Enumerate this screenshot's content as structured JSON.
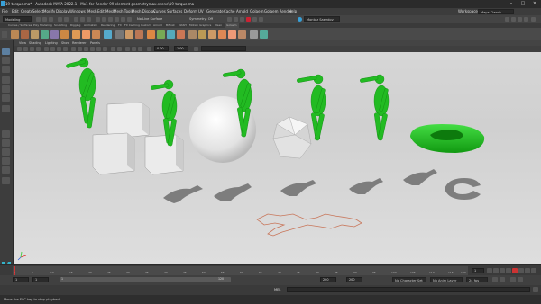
{
  "window": {
    "title": "19-torque.ma* - Autodesk MAYA 2022.1 - Mo1 for Render 99 element geometrymax.scene\\19-torque.ma"
  },
  "menubar": {
    "items": [
      "File",
      "Edit",
      "Create",
      "Select",
      "Modify",
      "Display",
      "Windows",
      "Mesh",
      "Edit Mesh",
      "Mesh Tools",
      "Mesh Display",
      "Curves",
      "Surfaces",
      "Deform",
      "UV",
      "Generate",
      "Cache",
      "Arnold",
      "Golaem",
      "Golaem Render",
      "Help"
    ],
    "workspace_label": "Workspace:",
    "workspace_value": "Maya Classic"
  },
  "statusline": {
    "mode": "Modeling",
    "no_live_surface": "No Live Surface",
    "symmetry": "Symmetry: Off",
    "sign_in": "Montaz Saeedov"
  },
  "shelf": {
    "tabs": [
      "Curves / Surfaces",
      "Poly Modeling",
      "Sculpting",
      "Rigging",
      "Animation",
      "Rendering",
      "FX",
      "FX Caching",
      "Custom",
      "Arnold",
      "Bifrost",
      "MASH",
      "Motion Graphics",
      "XGen",
      "Golaem"
    ]
  },
  "panel": {
    "menus": [
      "View",
      "Shading",
      "Lighting",
      "Show",
      "Renderer",
      "Panels"
    ],
    "near": "0.00",
    "far": "1.00"
  },
  "timeslider": {
    "ticks": [
      "1",
      "5",
      "10",
      "15",
      "20",
      "25",
      "30",
      "35",
      "40",
      "45",
      "50",
      "55",
      "60",
      "65",
      "70",
      "75",
      "80",
      "85",
      "90",
      "95",
      "100",
      "105",
      "110",
      "115",
      "120"
    ],
    "current_frame": "1"
  },
  "rangeslider": {
    "start": "1",
    "playback_start": "1",
    "range_label": "1",
    "range_end_label": "120",
    "playback_end": "200",
    "end": "200",
    "character_set": "No Character Set",
    "anim_layer": "No Anim Layer",
    "fps": "24 fps"
  },
  "cmdline": {
    "lang": "MEL"
  },
  "helpline": {
    "text": "Move the ESC key to stop playback."
  },
  "colors": {
    "character": "#22bb22",
    "accent": "#38a0d8",
    "path": "#c8765a"
  },
  "icons": {
    "logo": "maya-logo-icon",
    "shelf": "character-icons",
    "playback": "playback-controls"
  }
}
